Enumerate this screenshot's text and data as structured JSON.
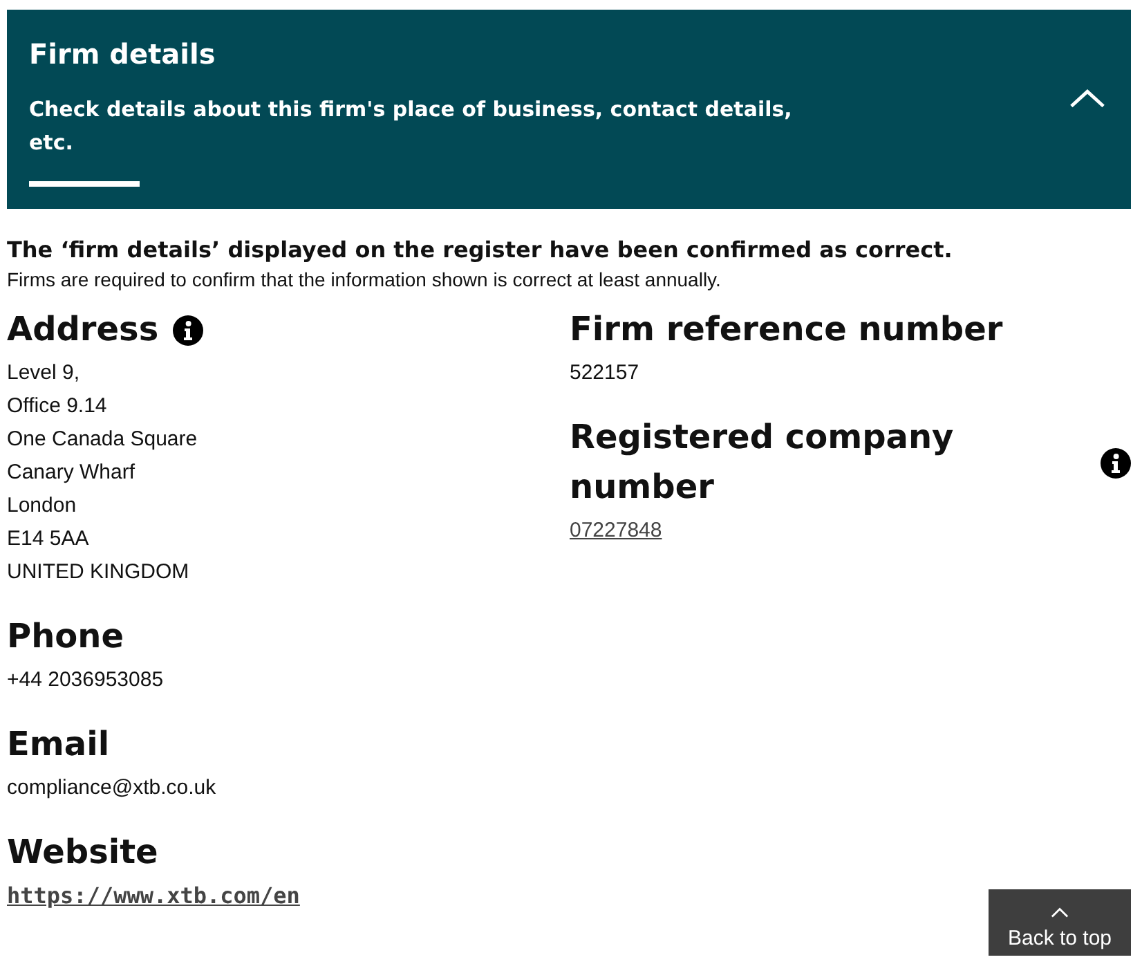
{
  "panel": {
    "title": "Firm details",
    "subtitle": "Check details about this firm's place of business, contact details, etc.",
    "expanded": true
  },
  "confirmation": {
    "heading": "The ‘firm details’ displayed on the register have been confirmed as correct.",
    "note": "Firms are required to confirm that the information shown is correct at least annually."
  },
  "columns": [
    [
      {
        "heading": "Address",
        "info": true,
        "kind": "text",
        "lines": [
          "Level 9,",
          "Office 9.14",
          "One Canada Square",
          "Canary Wharf",
          "London",
          "E14 5AA",
          "UNITED KINGDOM"
        ]
      },
      {
        "heading": "Phone",
        "info": false,
        "kind": "text",
        "lines": [
          "+44 2036953085"
        ]
      },
      {
        "heading": "Email",
        "info": false,
        "kind": "text",
        "lines": [
          "compliance@xtb.co.uk"
        ]
      },
      {
        "heading": "Website",
        "info": false,
        "kind": "url",
        "lines": [
          "https://www.xtb.com/en"
        ]
      }
    ],
    [
      {
        "heading": "Firm reference number",
        "info": false,
        "kind": "text",
        "lines": [
          "522157"
        ]
      },
      {
        "heading": "Registered company number",
        "info": true,
        "kind": "link",
        "lines": [
          "07227848"
        ]
      }
    ]
  ],
  "back_to_top": {
    "label": "Back to top"
  }
}
